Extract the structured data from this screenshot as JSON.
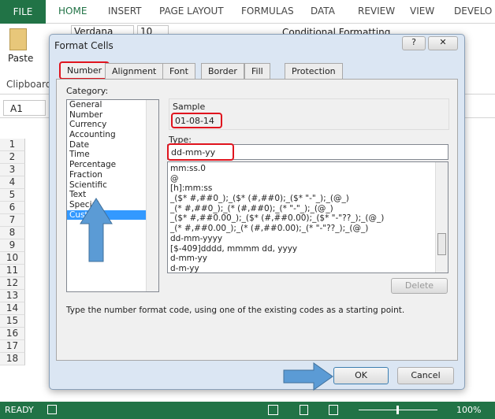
{
  "ribbon": {
    "tabs": [
      "FILE",
      "HOME",
      "INSERT",
      "PAGE LAYOUT",
      "FORMULAS",
      "DATA",
      "REVIEW",
      "VIEW",
      "DEVELO"
    ],
    "active": "HOME",
    "paste_label": "Paste",
    "clipboard_label": "Clipboard",
    "font_name": "Verdana",
    "font_size": "10",
    "conditional_formatting": "Conditional Formatting"
  },
  "formula_bar": {
    "name_box": "A1"
  },
  "grid": {
    "rows": [
      "1",
      "2",
      "3",
      "4",
      "5",
      "6",
      "7",
      "8",
      "9",
      "10",
      "11",
      "12",
      "13",
      "14",
      "15",
      "16",
      "17",
      "18"
    ]
  },
  "dialog": {
    "title": "Format Cells",
    "help": "?",
    "close": "✕",
    "tabs": [
      "Number",
      "Alignment",
      "Font",
      "Border",
      "Fill",
      "Protection"
    ],
    "active_tab": "Number",
    "category_label": "Category:",
    "categories": [
      "General",
      "Number",
      "Currency",
      "Accounting",
      "Date",
      "Time",
      "Percentage",
      "Fraction",
      "Scientific",
      "Text",
      "Special",
      "Custom"
    ],
    "selected_category": "Custom",
    "sample_label": "Sample",
    "sample_value": "01-08-14",
    "type_label": "Type:",
    "type_value": "dd-mm-yy",
    "formats": [
      "mm:ss.0",
      "@",
      "[h]:mm:ss",
      "_($* #,##0_);_($* (#,##0);_($* \"-\"_);_(@_)",
      "_(* #,##0_);_(* (#,##0);_(* \"-\"_);_(@_)",
      "_($* #,##0.00_);_($* (#,##0.00);_($* \"-\"??_);_(@_)",
      "_(* #,##0.00_);_(* (#,##0.00);_(* \"-\"??_);_(@_)",
      "dd-mm-yyyy",
      "[$-409]dddd, mmmm dd, yyyy",
      "d-mm-yy",
      "d-m-yy"
    ],
    "delete_label": "Delete",
    "description": "Type the number format code, using one of the existing codes as a starting point.",
    "ok_label": "OK",
    "cancel_label": "Cancel"
  },
  "status": {
    "ready": "READY",
    "zoom": "100%"
  },
  "colors": {
    "excel_green": "#217346",
    "highlight_red": "#e0141e",
    "arrow_blue": "#5b9bd5",
    "selection": "#3399ff"
  }
}
